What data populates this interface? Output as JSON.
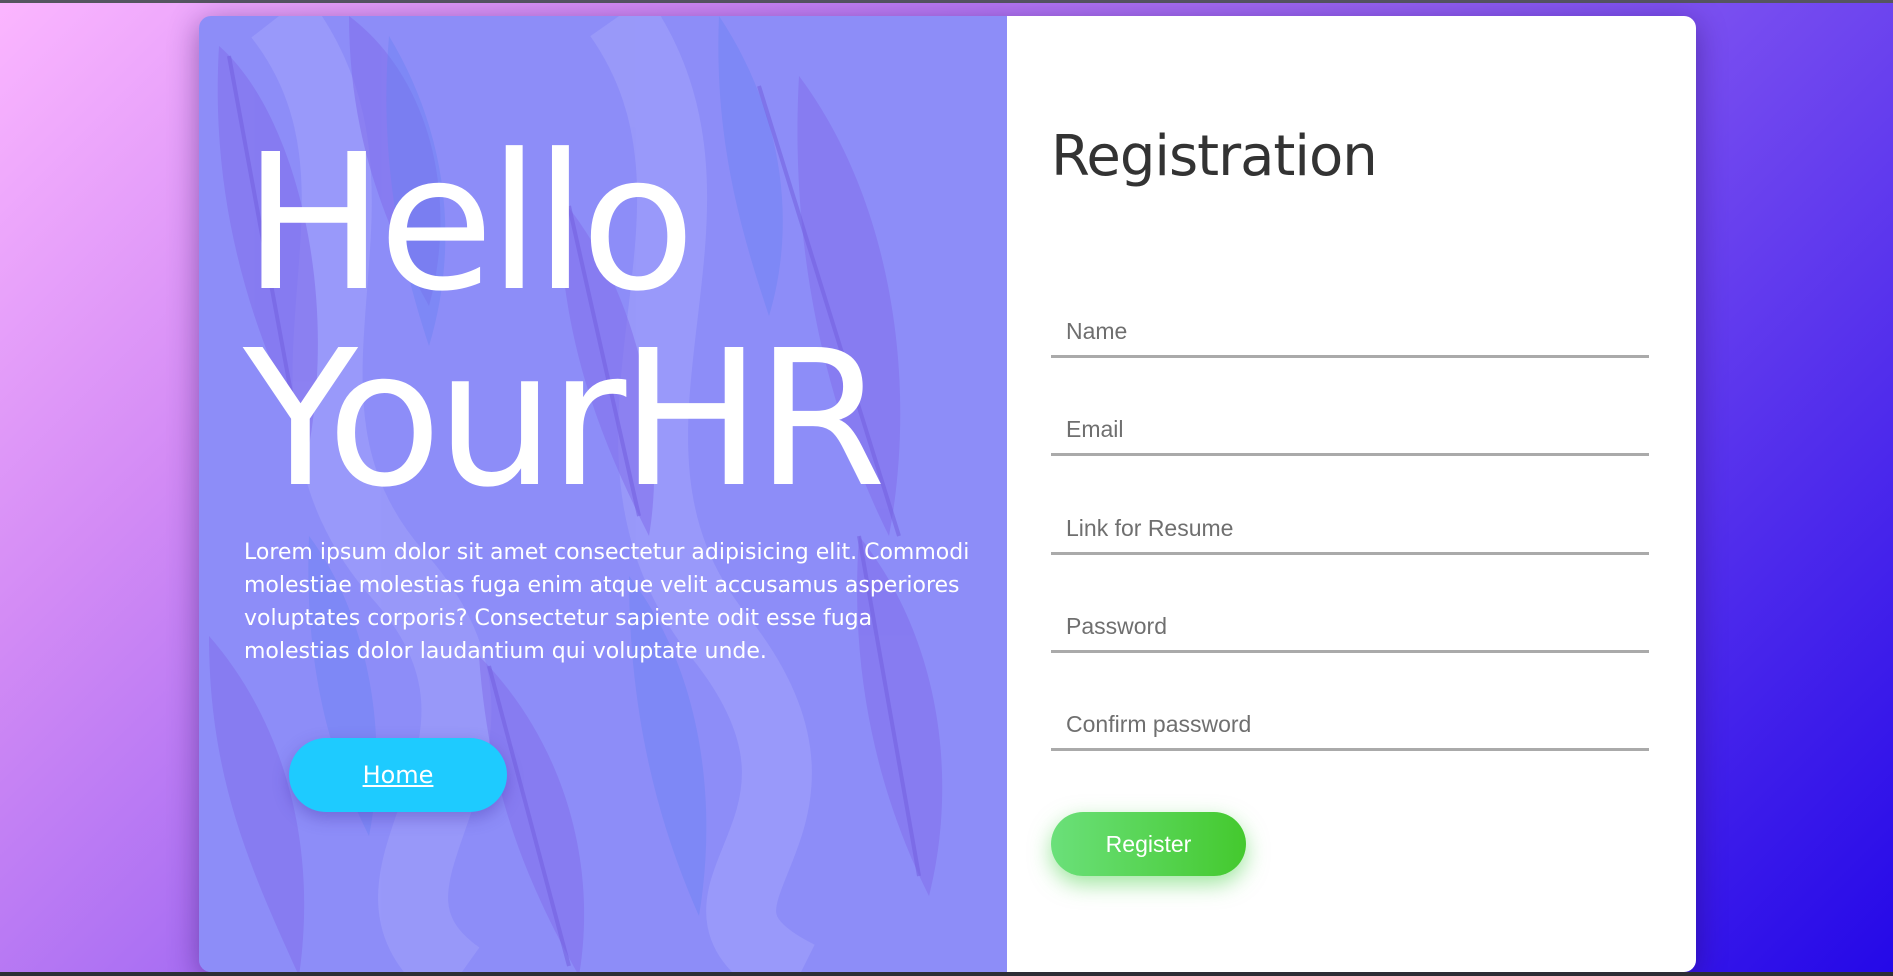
{
  "hero": {
    "title": "Hello YourHR",
    "description": "Lorem ipsum dolor sit amet consectetur adipisicing elit. Commodi molestiae molestias fuga enim atque velit accusamus asperiores voluptates corporis? Consectetur sapiente odit esse fuga molestias dolor laudantium qui voluptate unde.",
    "home_label": "Home"
  },
  "form": {
    "title": "Registration",
    "name_placeholder": "Name",
    "email_placeholder": "Email",
    "resume_placeholder": "Link for Resume",
    "password_placeholder": "Password",
    "confirm_placeholder": "Confirm password",
    "register_label": "Register"
  },
  "colors": {
    "home_button": "#1ecbff",
    "register_button": "#4fd13c",
    "hero_tint": "#8e8ef7",
    "title_text": "#333333"
  }
}
